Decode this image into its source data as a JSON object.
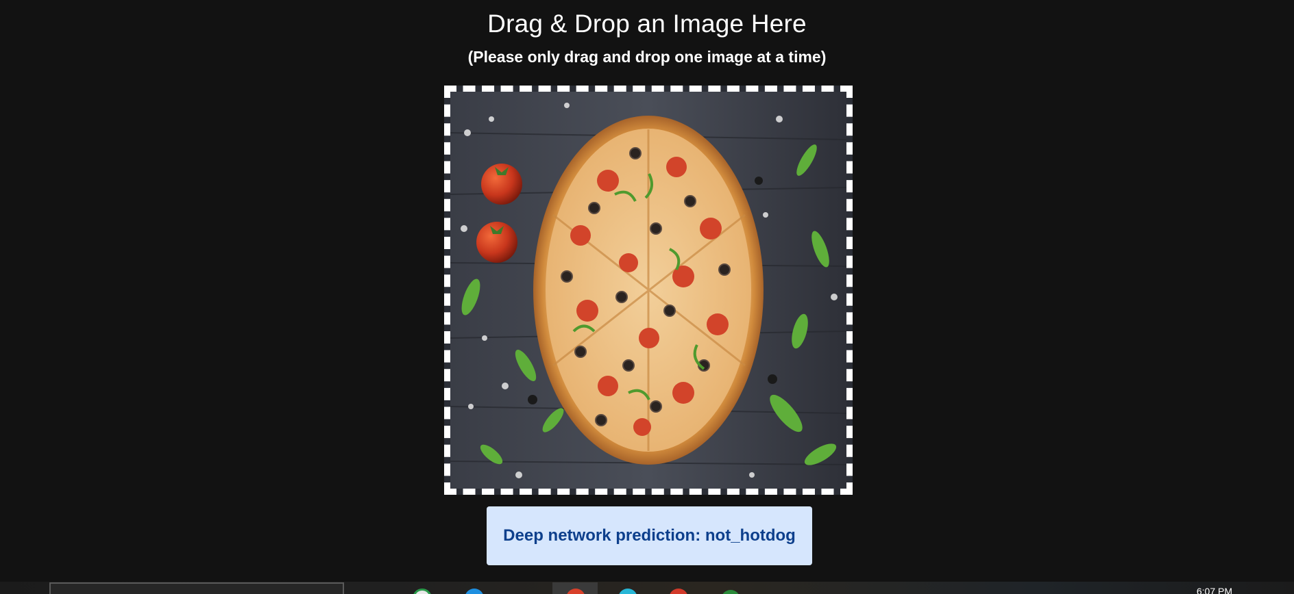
{
  "header": {
    "title": "Drag & Drop an Image Here",
    "subtitle": "(Please only drag and drop one image at a time)"
  },
  "dropzone": {
    "image_subject": "pizza-photo"
  },
  "prediction": {
    "text": "Deep network prediction: not_hotdog"
  },
  "taskbar": {
    "clock": "6:07 PM",
    "apps": [
      "chrome-icon",
      "edge-icon",
      "app-red-icon",
      "app-cyan-icon",
      "app-red-2-icon",
      "app-green-icon"
    ]
  },
  "colors": {
    "background": "#121212",
    "dropzone_border": "#ffffff",
    "prediction_bg": "#d6e6fd",
    "prediction_text": "#0d3f8c"
  }
}
